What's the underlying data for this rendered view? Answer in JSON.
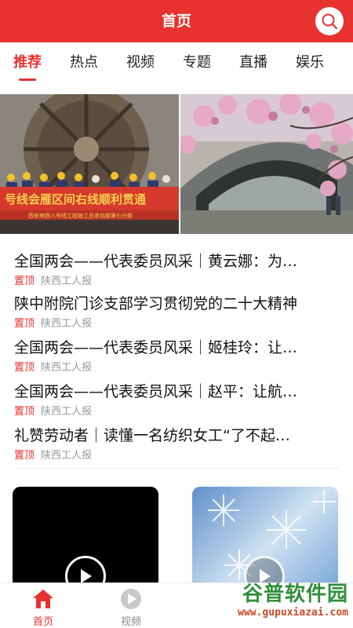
{
  "header": {
    "title": "首页",
    "search_icon": "search-icon"
  },
  "tabs": [
    {
      "label": "推荐",
      "active": true
    },
    {
      "label": "热点",
      "active": false
    },
    {
      "label": "视频",
      "active": false
    },
    {
      "label": "专题",
      "active": false
    },
    {
      "label": "直播",
      "active": false
    },
    {
      "label": "娱乐",
      "active": false
    }
  ],
  "banner": {
    "left_caption": "号线会雁区间右线顺利贯通",
    "left_subcaption": "西安地铁八号线工程施工总承包部第七分部"
  },
  "news": [
    {
      "title": "全国两会——代表委员风采｜黄云娜：为…",
      "tag": "置顶",
      "source": "陕西工人报"
    },
    {
      "title": "陕中附院门诊支部学习贯彻党的二十大精神",
      "tag": "置顶",
      "source": "陕西工人报"
    },
    {
      "title": "全国两会——代表委员风采｜姬桂玲：让…",
      "tag": "置顶",
      "source": "陕西工人报"
    },
    {
      "title": "全国两会——代表委员风采｜赵平：让航…",
      "tag": "置顶",
      "source": "陕西工人报"
    },
    {
      "title": "礼赞劳动者｜读懂一名纺织女工“了不起…",
      "tag": "置顶",
      "source": "陕西工人报"
    }
  ],
  "bottom_nav": [
    {
      "label": "首页",
      "icon": "home-icon",
      "active": true
    },
    {
      "label": "视频",
      "icon": "play-circle-icon",
      "active": false
    }
  ],
  "watermark": {
    "text": "谷普软件园",
    "url": "www.gupuxiazai.com"
  },
  "colors": {
    "accent": "#e8322f",
    "muted": "#9a9a9a"
  }
}
